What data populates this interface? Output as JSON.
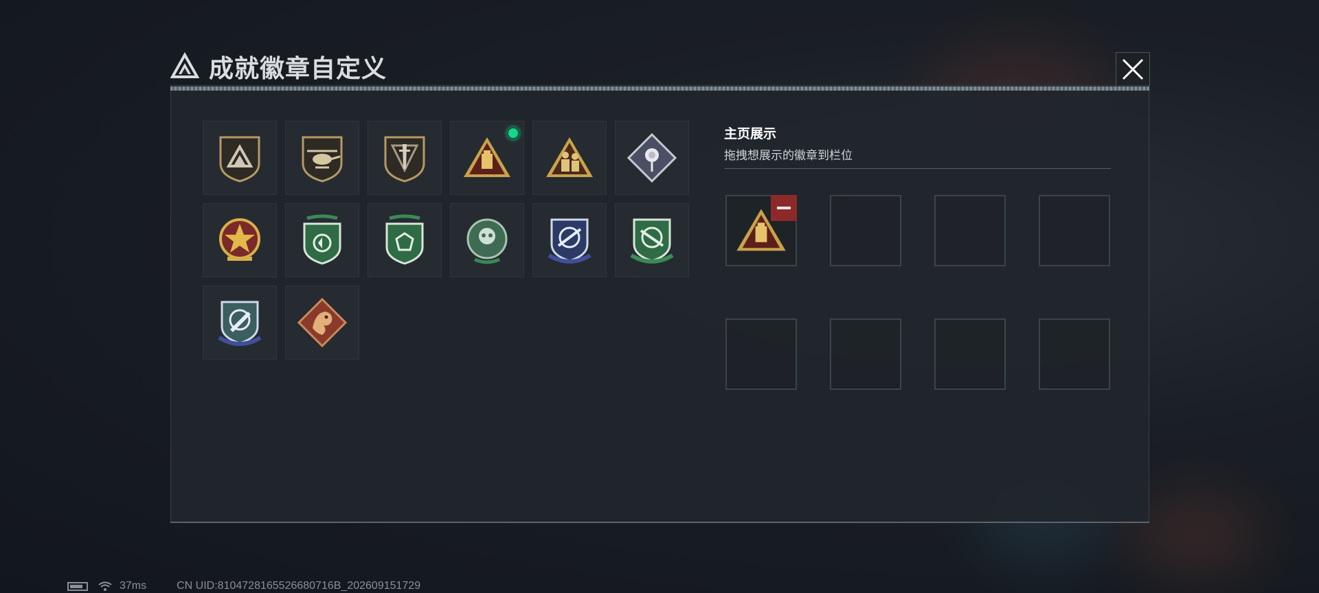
{
  "title": "成就徽章自定义",
  "close_label": "close",
  "badges": [
    {
      "id": "badge-delta-shield"
    },
    {
      "id": "badge-helicopter-shield"
    },
    {
      "id": "badge-dagger-shield"
    },
    {
      "id": "badge-pyramid-vault",
      "is_new": true
    },
    {
      "id": "badge-soldiers-triangle"
    },
    {
      "id": "badge-rose-diamond"
    },
    {
      "id": "badge-star-medal"
    },
    {
      "id": "badge-green-shield-arrows"
    },
    {
      "id": "badge-green-shield-gem"
    },
    {
      "id": "badge-green-skull-crest"
    },
    {
      "id": "badge-blue-rifle-shield"
    },
    {
      "id": "badge-green-rifle-shield"
    },
    {
      "id": "badge-blue-knife-shield"
    },
    {
      "id": "badge-dragon-diamond"
    }
  ],
  "showcase": {
    "title": "主页展示",
    "subtitle": "拖拽想展示的徽章到栏位",
    "slots": [
      {
        "badge": "badge-pyramid-vault"
      },
      {
        "badge": null
      },
      {
        "badge": null
      },
      {
        "badge": null
      },
      {
        "badge": null
      },
      {
        "badge": null
      },
      {
        "badge": null
      },
      {
        "badge": null
      }
    ]
  },
  "status": {
    "ping": "37ms",
    "uid": "CN UID:8104728165526680716B_202609151729"
  },
  "colors": {
    "accent_green": "#19d48b",
    "remove_red": "#8c2a2a",
    "gold": "#c9a24a"
  }
}
